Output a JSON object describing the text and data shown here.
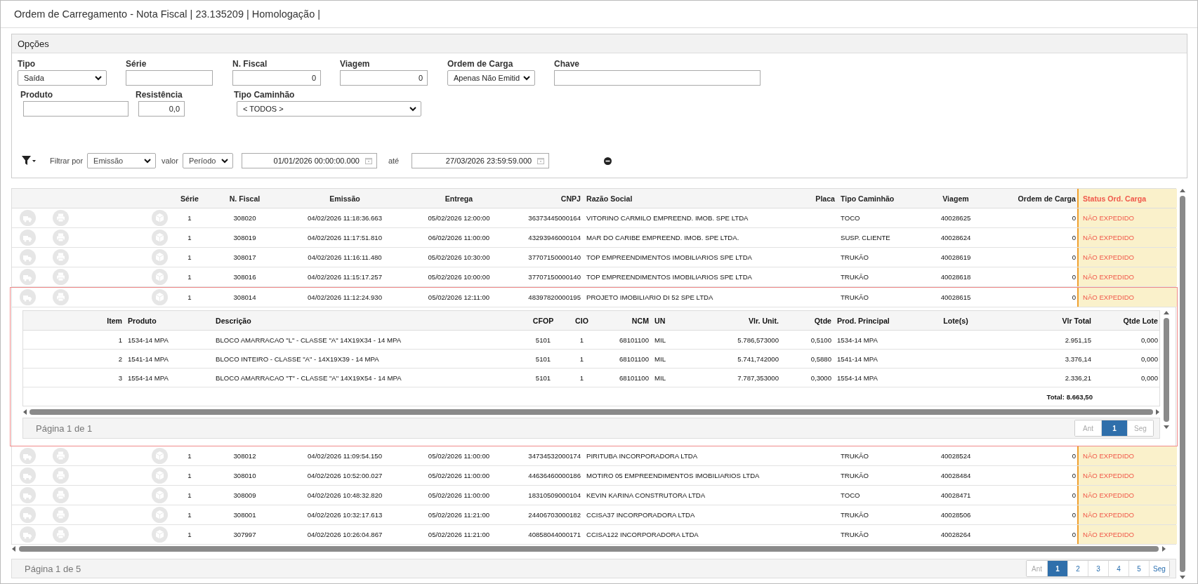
{
  "window": {
    "title": "Ordem de Carregamento - Nota Fiscal | 23.135209 | Homologação |"
  },
  "options": {
    "title": "Opções",
    "fields": [
      {
        "label": "Tipo",
        "kind": "select",
        "value": "Saída"
      },
      {
        "label": "Série",
        "kind": "text"
      },
      {
        "label": "N. Fiscal",
        "kind": "number",
        "value": "0"
      },
      {
        "label": "Viagem",
        "kind": "number",
        "value": "0"
      },
      {
        "label": "Ordem de Carga",
        "kind": "select",
        "value": "Apenas Não Emitid"
      },
      {
        "label": "Chave",
        "kind": "text"
      },
      {
        "label": "Produto",
        "kind": "text"
      },
      {
        "label": "Resistência",
        "kind": "number",
        "value": "0,0"
      },
      {
        "label": "Tipo Caminhão",
        "kind": "select",
        "value": "< TODOS >"
      }
    ],
    "filter": {
      "filter_by_label": "Filtrar por",
      "filter_by": "Emissão",
      "value_label": "valor",
      "value": "Período",
      "from": "01/01/2026 00:00:00.000",
      "to_label": "até",
      "to": "27/03/2026 23:59:59.000"
    }
  },
  "table": {
    "columns": [
      "Série",
      "N. Fiscal",
      "Emissão",
      "Entrega",
      "CNPJ",
      "Razão Social",
      "Placa",
      "Tipo Caminhão",
      "Viagem",
      "Ordem de Carga",
      "Status Ord. Carga"
    ],
    "rows": [
      {
        "serie": "1",
        "n_fiscal": "308020",
        "emissao": "04/02/2026 11:18:36.663",
        "entrega": "05/02/2026 12:00:00",
        "cnpj": "36373445000164",
        "razao_social": "VITORINO CARMILO EMPREEND. IMOB. SPE LTDA",
        "tipo_caminhao": "TOCO",
        "viagem": "40028625",
        "ordem_de_carga": "0",
        "status": "NÃO EXPEDIDO",
        "expanded": false
      },
      {
        "serie": "1",
        "n_fiscal": "308019",
        "emissao": "04/02/2026 11:17:51.810",
        "entrega": "06/02/2026 11:00:00",
        "cnpj": "43293946000104",
        "razao_social": "MAR DO CARIBE EMPREEND. IMOB. SPE LTDA.",
        "tipo_caminhao": "SUSP. CLIENTE",
        "viagem": "40028624",
        "ordem_de_carga": "0",
        "status": "NÃO EXPEDIDO",
        "expanded": false
      },
      {
        "serie": "1",
        "n_fiscal": "308017",
        "emissao": "04/02/2026 11:16:11.480",
        "entrega": "05/02/2026 10:30:00",
        "cnpj": "37707150000140",
        "razao_social": "TOP EMPREENDIMENTOS IMOBILIARIOS SPE LTDA",
        "tipo_caminhao": "TRUKÃO",
        "viagem": "40028619",
        "ordem_de_carga": "0",
        "status": "NÃO EXPEDIDO",
        "expanded": false
      },
      {
        "serie": "1",
        "n_fiscal": "308016",
        "emissao": "04/02/2026 11:15:17.257",
        "entrega": "05/02/2026 10:00:00",
        "cnpj": "37707150000140",
        "razao_social": "TOP EMPREENDIMENTOS IMOBILIARIOS SPE LTDA",
        "tipo_caminhao": "TRUKÃO",
        "viagem": "40028618",
        "ordem_de_carga": "0",
        "status": "NÃO EXPEDIDO",
        "expanded": false
      },
      {
        "serie": "1",
        "n_fiscal": "308014",
        "emissao": "04/02/2026 11:12:24.930",
        "entrega": "05/02/2026 12:11:00",
        "cnpj": "48397820000195",
        "razao_social": "PROJETO IMOBILIARIO DI 52 SPE LTDA",
        "tipo_caminhao": "TRUKÃO",
        "viagem": "40028615",
        "ordem_de_carga": "0",
        "status": "NÃO EXPEDIDO",
        "expanded": true,
        "detail": {
          "columns": [
            "Item",
            "Produto",
            "Descrição",
            "CFOP",
            "CIO",
            "NCM",
            "UN",
            "Vlr. Unit.",
            "Qtde",
            "Prod. Principal",
            "Lote(s)",
            "Vlr Total",
            "Qtde Lote"
          ],
          "rows": [
            {
              "item": "1",
              "produto": "1534-14 MPA",
              "descricao": "BLOCO AMARRACAO \"L\" - CLASSE \"A\" 14X19X34 - 14 MPA",
              "cfop": "5101",
              "cio": "1",
              "ncm": "68101100",
              "un": "MIL",
              "vlr_unit": "5.786,573000",
              "qtde": "0,5100",
              "prod_principal": "1534-14 MPA",
              "vlr_total": "2.951,15",
              "qtde_lote": "0,000"
            },
            {
              "item": "2",
              "produto": "1541-14 MPA",
              "descricao": "BLOCO INTEIRO - CLASSE \"A\" - 14X19X39 - 14 MPA",
              "cfop": "5101",
              "cio": "1",
              "ncm": "68101100",
              "un": "MIL",
              "vlr_unit": "5.741,742000",
              "qtde": "0,5880",
              "prod_principal": "1541-14 MPA",
              "vlr_total": "3.376,14",
              "qtde_lote": "0,000"
            },
            {
              "item": "3",
              "produto": "1554-14 MPA",
              "descricao": "BLOCO AMARRACAO \"T\" - CLASSE \"A\" 14X19X54 - 14 MPA",
              "cfop": "5101",
              "cio": "1",
              "ncm": "68101100",
              "un": "MIL",
              "vlr_unit": "7.787,353000",
              "qtde": "0,3000",
              "prod_principal": "1554-14 MPA",
              "vlr_total": "2.336,21",
              "qtde_lote": "0,000"
            }
          ],
          "total": "Total: 8.663,50",
          "pager": {
            "label": "Página 1 de 1",
            "pages": [
              {
                "label": "Ant",
                "selected": false,
                "disabled": true
              },
              {
                "label": "1",
                "selected": true,
                "disabled": false
              },
              {
                "label": "Seg",
                "selected": false,
                "disabled": true
              }
            ]
          }
        }
      },
      {
        "serie": "1",
        "n_fiscal": "308012",
        "emissao": "04/02/2026 11:09:54.150",
        "entrega": "05/02/2026 11:00:00",
        "cnpj": "34734532000174",
        "razao_social": "PIRITUBA INCORPORADORA LTDA",
        "tipo_caminhao": "TRUKÃO",
        "viagem": "40028524",
        "ordem_de_carga": "0",
        "status": "NÃO EXPEDIDO",
        "expanded": false
      },
      {
        "serie": "1",
        "n_fiscal": "308010",
        "emissao": "04/02/2026 10:52:00.027",
        "entrega": "05/02/2026 11:00:00",
        "cnpj": "44636460000186",
        "razao_social": "MOTIRO 05 EMPREENDIMENTOS IMOBILIARIOS LTDA",
        "tipo_caminhao": "TRUKÃO",
        "viagem": "40028484",
        "ordem_de_carga": "0",
        "status": "NÃO EXPEDIDO",
        "expanded": false
      },
      {
        "serie": "1",
        "n_fiscal": "308009",
        "emissao": "04/02/2026 10:48:32.820",
        "entrega": "05/02/2026 11:00:00",
        "cnpj": "18310509000104",
        "razao_social": "KEVIN KARINA CONSTRUTORA LTDA",
        "tipo_caminhao": "TOCO",
        "viagem": "40028471",
        "ordem_de_carga": "0",
        "status": "NÃO EXPEDIDO",
        "expanded": false
      },
      {
        "serie": "1",
        "n_fiscal": "308001",
        "emissao": "04/02/2026 10:32:17.613",
        "entrega": "05/02/2026 11:21:00",
        "cnpj": "24406703000182",
        "razao_social": "CCISA37 INCORPORADORA LTDA",
        "tipo_caminhao": "TRUKÃO",
        "viagem": "40028506",
        "ordem_de_carga": "0",
        "status": "NÃO EXPEDIDO",
        "expanded": false
      },
      {
        "serie": "1",
        "n_fiscal": "307997",
        "emissao": "04/02/2026 10:26:04.867",
        "entrega": "05/02/2026 11:21:00",
        "cnpj": "40858044000171",
        "razao_social": "CCISA122 INCORPORADORA LTDA",
        "tipo_caminhao": "TRUKÃO",
        "viagem": "40028264",
        "ordem_de_carga": "0",
        "status": "NÃO EXPEDIDO",
        "expanded": false
      }
    ]
  },
  "pager": {
    "label": "Página 1 de 5",
    "pages": [
      {
        "label": "Ant",
        "selected": false,
        "disabled": true
      },
      {
        "label": "1",
        "selected": true,
        "disabled": false
      },
      {
        "label": "2",
        "selected": false,
        "disabled": false
      },
      {
        "label": "3",
        "selected": false,
        "disabled": false
      },
      {
        "label": "4",
        "selected": false,
        "disabled": false
      },
      {
        "label": "5",
        "selected": false,
        "disabled": false
      },
      {
        "label": "Seg",
        "selected": false,
        "disabled": false
      }
    ]
  }
}
